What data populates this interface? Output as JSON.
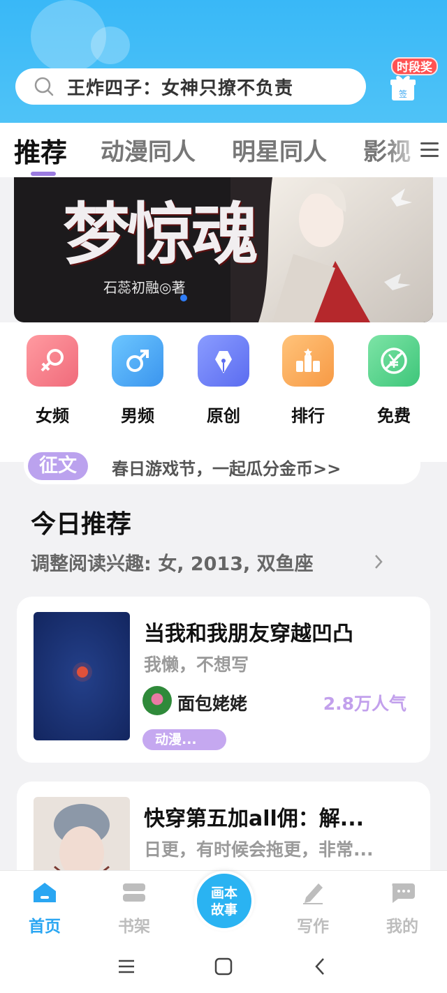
{
  "search": {
    "placeholder": "王炸四子：女神只撩不负责"
  },
  "gift": {
    "badge": "时段奖",
    "label": "签"
  },
  "tabs": [
    {
      "label": "推荐",
      "active": true
    },
    {
      "label": "动漫同人"
    },
    {
      "label": "明星同人"
    },
    {
      "label": "影视"
    }
  ],
  "banner": {
    "title": "梦惊魂",
    "author": "石蕊初融◎著"
  },
  "categories": [
    {
      "label": "女频",
      "icon": "female-icon",
      "color": "#f47c86"
    },
    {
      "label": "男频",
      "icon": "male-icon",
      "color": "#4aa6f4"
    },
    {
      "label": "原创",
      "icon": "pen-nib-icon",
      "color": "#6b7cf2"
    },
    {
      "label": "排行",
      "icon": "ranking-icon",
      "color": "#f9a552"
    },
    {
      "label": "免费",
      "icon": "free-yen-icon",
      "color": "#4ed084"
    }
  ],
  "notice": {
    "tag": "征文",
    "text": "春日游戏节，一起瓜分金币>>"
  },
  "recommend": {
    "title": "今日推荐",
    "subtitle": "调整阅读兴趣: 女, 2013, 双鱼座"
  },
  "books": [
    {
      "title": "当我和我朋友穿越凹凸",
      "desc": "我懒，不想写",
      "author": "面包姥姥",
      "popularity": "2.8万人气",
      "tag": "动漫..."
    },
    {
      "title": "快穿第五加all佣：解...",
      "desc": "日更，有时候会拖更，非常..."
    }
  ],
  "nav": {
    "home": "首页",
    "shelf": "书架",
    "center": "画本故事",
    "center_line1": "画本",
    "center_line2": "故事",
    "write": "写作",
    "mine": "我的"
  },
  "colors": {
    "accent": "#2aa6f2",
    "header": "#39b8f7",
    "purple": "#bba2ee"
  }
}
